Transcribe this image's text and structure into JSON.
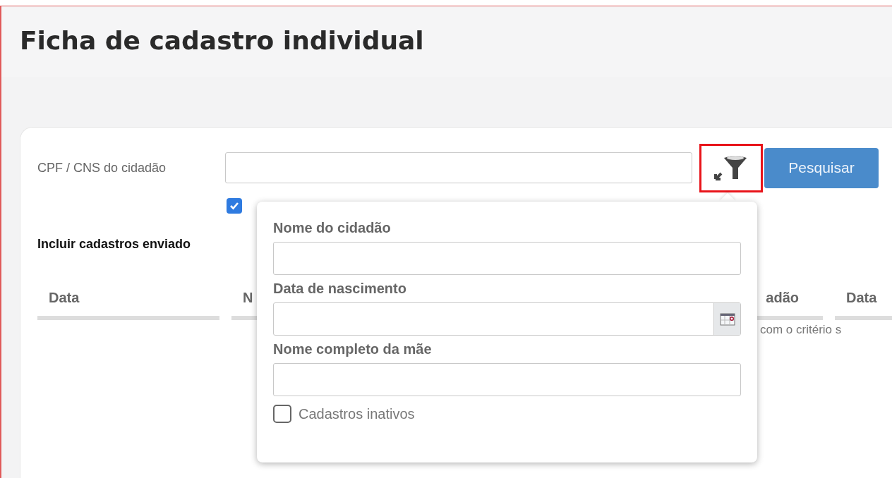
{
  "page": {
    "title": "Ficha de cadastro individual"
  },
  "search": {
    "label": "CPF / CNS do cidadão",
    "filter_highlighted": true,
    "button": "Pesquisar"
  },
  "option": {
    "checked": true
  },
  "include_label": "Incluir cadastros enviado",
  "table": {
    "columns": [
      {
        "label": "Data"
      },
      {
        "label": "N"
      },
      {
        "label": "adão"
      },
      {
        "label": "Data"
      }
    ],
    "empty_message": "com o critério s"
  },
  "filter_popover": {
    "fields": [
      {
        "kind": "text",
        "label": "Nome do cidadão"
      },
      {
        "kind": "date",
        "label": "Data de nascimento"
      },
      {
        "kind": "text",
        "label": "Nome completo da mãe"
      }
    ],
    "checkbox": {
      "label": "Cadastros inativos",
      "checked": false
    }
  }
}
